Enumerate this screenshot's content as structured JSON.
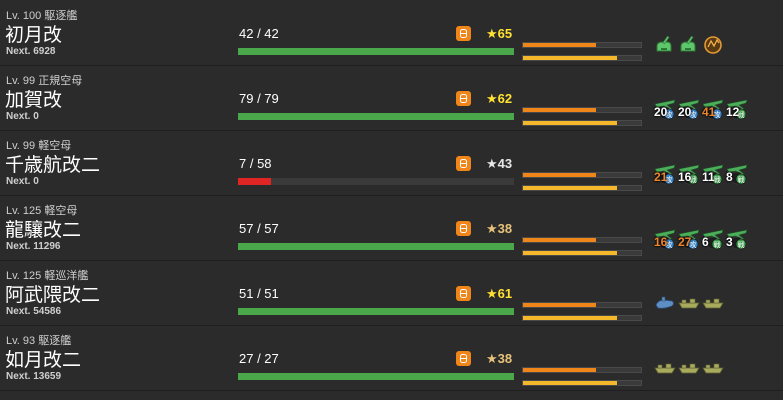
{
  "colors": {
    "hp_green": "#4aa84a",
    "hp_red": "#e02525",
    "fuel_orange": "#f0851a",
    "ammo_yellow": "#f5b82b",
    "cond_sparkle": "#ffe033",
    "cond_normal": "#e8c27a",
    "cond_plain": "#e6e6e6"
  },
  "ships": [
    {
      "level": "Lv. 100",
      "type": "駆逐艦",
      "name": "初月改",
      "next": "Next. 6928",
      "hp_text": "42 / 42",
      "hp_fraction": 1.0,
      "hp_color": "green",
      "condition": "★65",
      "condition_style": "sparkle",
      "fuel_fraction": 0.62,
      "ammo_fraction": 0.8,
      "equipment": [
        {
          "icon": "aa-gun-icon",
          "count": ""
        },
        {
          "icon": "aa-gun-icon",
          "count": ""
        },
        {
          "icon": "aa-radar-icon",
          "count": ""
        }
      ]
    },
    {
      "level": "Lv. 99",
      "type": "正規空母",
      "name": "加賀改",
      "next": "Next. 0",
      "hp_text": "79 / 79",
      "hp_fraction": 1.0,
      "hp_color": "green",
      "condition": "★62",
      "condition_style": "sparkle",
      "fuel_fraction": 0.62,
      "ammo_fraction": 0.8,
      "equipment": [
        {
          "icon": "fighter-plane-icon",
          "count": "20",
          "badge": "攻"
        },
        {
          "icon": "fighter-plane-icon",
          "count": "20",
          "badge": "攻"
        },
        {
          "icon": "fighter-plane-icon",
          "count": "41",
          "badge": "攻",
          "warn": true
        },
        {
          "icon": "fighter-plane-icon",
          "count": "12",
          "badge": "戦"
        }
      ]
    },
    {
      "level": "Lv. 99",
      "type": "軽空母",
      "name": "千歳航改二",
      "next": "Next. 0",
      "hp_text": "7 / 58",
      "hp_fraction": 0.12,
      "hp_color": "red",
      "condition": "★43",
      "condition_style": "plain",
      "fuel_fraction": 0.62,
      "ammo_fraction": 0.8,
      "equipment": [
        {
          "icon": "fighter-plane-icon",
          "count": "21",
          "badge": "攻",
          "warn": true
        },
        {
          "icon": "fighter-plane-icon",
          "count": "16",
          "badge": "戦"
        },
        {
          "icon": "fighter-plane-icon",
          "count": "11",
          "badge": "戦"
        },
        {
          "icon": "fighter-plane-icon",
          "count": "8",
          "badge": "戦"
        }
      ]
    },
    {
      "level": "Lv. 125",
      "type": "軽空母",
      "name": "龍驤改二",
      "next": "Next. 11296",
      "hp_text": "57 / 57",
      "hp_fraction": 1.0,
      "hp_color": "green",
      "condition": "★38",
      "condition_style": "normal",
      "fuel_fraction": 0.62,
      "ammo_fraction": 0.8,
      "equipment": [
        {
          "icon": "fighter-plane-icon",
          "count": "16",
          "badge": "攻",
          "warn": true
        },
        {
          "icon": "fighter-plane-icon",
          "count": "27",
          "badge": "攻",
          "warn": true
        },
        {
          "icon": "fighter-plane-icon",
          "count": "6",
          "badge": "戦"
        },
        {
          "icon": "fighter-plane-icon",
          "count": "3",
          "badge": "戦"
        }
      ]
    },
    {
      "level": "Lv. 125",
      "type": "軽巡洋艦",
      "name": "阿武隈改二",
      "next": "Next. 54586",
      "hp_text": "51 / 51",
      "hp_fraction": 1.0,
      "hp_color": "green",
      "condition": "★61",
      "condition_style": "sparkle",
      "fuel_fraction": 0.62,
      "ammo_fraction": 0.8,
      "equipment": [
        {
          "icon": "midget-submarine-icon",
          "count": ""
        },
        {
          "icon": "landing-craft-icon",
          "count": ""
        },
        {
          "icon": "landing-craft-icon",
          "count": ""
        }
      ]
    },
    {
      "level": "Lv. 93",
      "type": "駆逐艦",
      "name": "如月改二",
      "next": "Next. 13659",
      "hp_text": "27 / 27",
      "hp_fraction": 1.0,
      "hp_color": "green",
      "condition": "★38",
      "condition_style": "normal",
      "fuel_fraction": 0.62,
      "ammo_fraction": 0.8,
      "equipment": [
        {
          "icon": "landing-craft-icon",
          "count": ""
        },
        {
          "icon": "landing-craft-icon",
          "count": ""
        },
        {
          "icon": "landing-craft-icon",
          "count": ""
        }
      ]
    }
  ]
}
